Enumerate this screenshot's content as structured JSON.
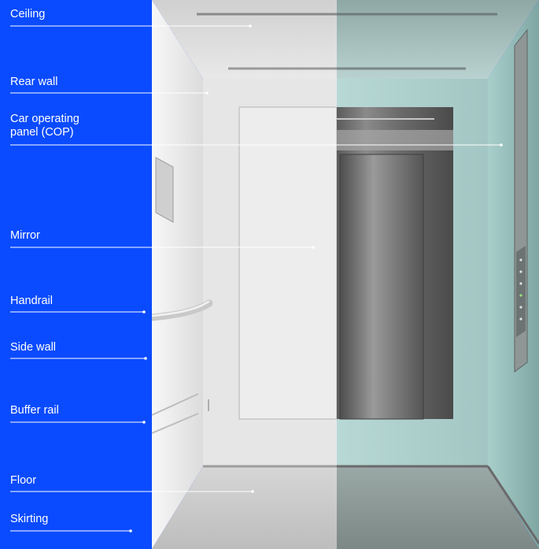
{
  "labels": [
    {
      "id": "ceiling",
      "text": "Ceiling"
    },
    {
      "id": "rear-wall",
      "text": "Rear wall"
    },
    {
      "id": "cop",
      "text": "Car operating\npanel (COP)"
    },
    {
      "id": "mirror",
      "text": "Mirror"
    },
    {
      "id": "handrail",
      "text": "Handrail"
    },
    {
      "id": "side-wall",
      "text": "Side wall"
    },
    {
      "id": "buffer-rail",
      "text": "Buffer rail"
    },
    {
      "id": "floor",
      "text": "Floor"
    },
    {
      "id": "skirting",
      "text": "Skirting"
    }
  ],
  "colors": {
    "sidebar": "#0a4bff",
    "label_text": "#ffffff",
    "leader_line": "#ffffff"
  }
}
